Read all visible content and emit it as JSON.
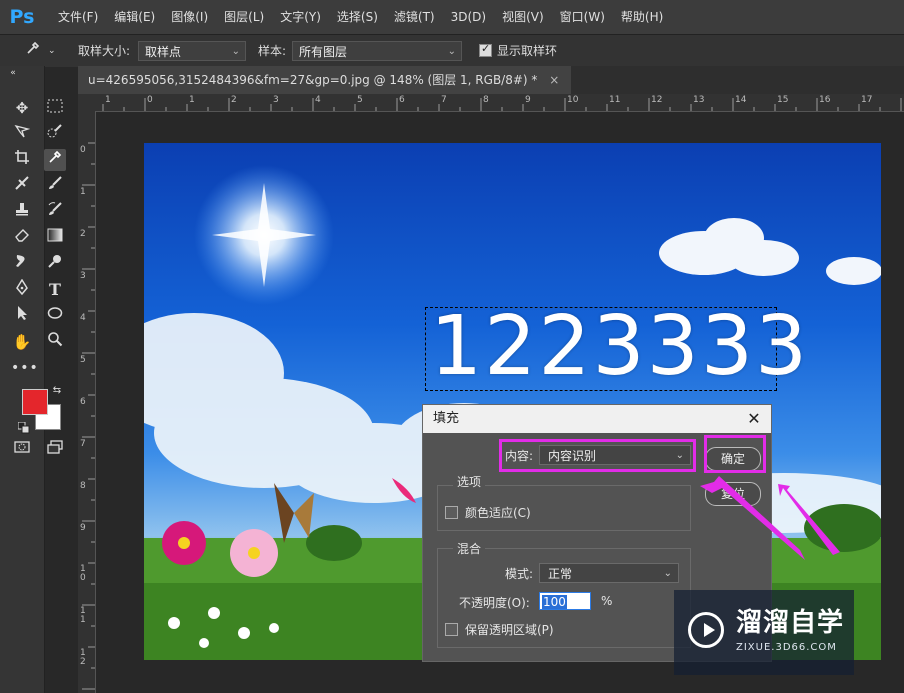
{
  "app": {
    "logo_text": "Ps"
  },
  "menu": [
    "文件(F)",
    "编辑(E)",
    "图像(I)",
    "图层(L)",
    "文字(Y)",
    "选择(S)",
    "滤镜(T)",
    "3D(D)",
    "视图(V)",
    "窗口(W)",
    "帮助(H)"
  ],
  "options_bar": {
    "sample_size_label": "取样大小:",
    "sample_size_value": "取样点",
    "sample_label": "样本:",
    "sample_value": "所有图层",
    "show_ring_label": "显示取样环",
    "show_ring_checked": true
  },
  "document_tab": {
    "title": "u=426595056,3152484396&fm=27&gp=0.jpg @ 148% (图层 1, RGB/8#) *",
    "close": "×"
  },
  "rulers": {
    "h_labels": [
      "1",
      "0",
      "1",
      "2",
      "3",
      "4",
      "5",
      "6",
      "7",
      "8",
      "9",
      "10",
      "11",
      "12",
      "13",
      "14",
      "15",
      "16",
      "17"
    ],
    "v_labels": [
      "0",
      "1",
      "2",
      "3",
      "4",
      "5",
      "6",
      "7",
      "8",
      "9",
      "1 0",
      "1 1",
      "1 2"
    ]
  },
  "colors": {
    "foreground": "#e4262c",
    "background": "#ffffff",
    "highlight": "#e22ce8",
    "accent": "#31a8ff"
  },
  "canvas": {
    "text_on_image": "1223333"
  },
  "fill_dialog": {
    "title": "填充",
    "close": "✕",
    "content_label": "内容:",
    "content_value": "内容识别",
    "options_group": "选项",
    "color_adapt_label": "颜色适应(C)",
    "color_adapt_checked": false,
    "blend_group": "混合",
    "mode_label": "模式:",
    "mode_value": "正常",
    "opacity_label": "不透明度(O):",
    "opacity_value": "100",
    "opacity_unit": "%",
    "preserve_label": "保留透明区域(P)",
    "preserve_checked": false,
    "ok_label": "确定",
    "reset_label": "复位"
  },
  "watermark": {
    "name": "溜溜自学",
    "url": "ZIXUE.3D66.COM"
  }
}
